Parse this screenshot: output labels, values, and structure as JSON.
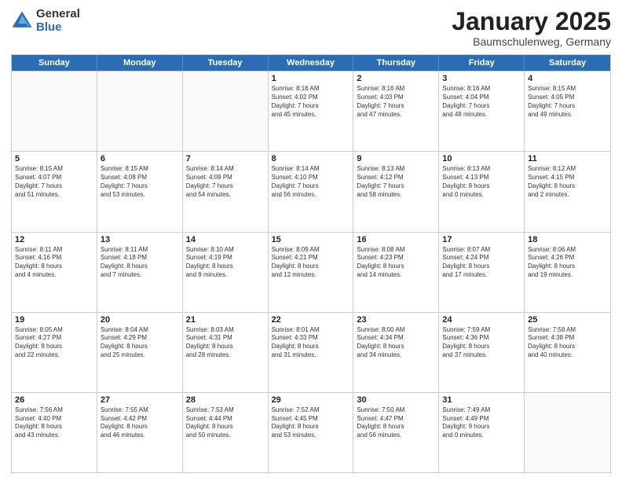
{
  "logo": {
    "general": "General",
    "blue": "Blue"
  },
  "header": {
    "month": "January 2025",
    "location": "Baumschulenweg, Germany"
  },
  "weekdays": [
    "Sunday",
    "Monday",
    "Tuesday",
    "Wednesday",
    "Thursday",
    "Friday",
    "Saturday"
  ],
  "weeks": [
    [
      {
        "day": "",
        "text": ""
      },
      {
        "day": "",
        "text": ""
      },
      {
        "day": "",
        "text": ""
      },
      {
        "day": "1",
        "text": "Sunrise: 8:16 AM\nSunset: 4:02 PM\nDaylight: 7 hours\nand 45 minutes."
      },
      {
        "day": "2",
        "text": "Sunrise: 8:16 AM\nSunset: 4:03 PM\nDaylight: 7 hours\nand 47 minutes."
      },
      {
        "day": "3",
        "text": "Sunrise: 8:16 AM\nSunset: 4:04 PM\nDaylight: 7 hours\nand 48 minutes."
      },
      {
        "day": "4",
        "text": "Sunrise: 8:15 AM\nSunset: 4:05 PM\nDaylight: 7 hours\nand 49 minutes."
      }
    ],
    [
      {
        "day": "5",
        "text": "Sunrise: 8:15 AM\nSunset: 4:07 PM\nDaylight: 7 hours\nand 51 minutes."
      },
      {
        "day": "6",
        "text": "Sunrise: 8:15 AM\nSunset: 4:08 PM\nDaylight: 7 hours\nand 53 minutes."
      },
      {
        "day": "7",
        "text": "Sunrise: 8:14 AM\nSunset: 4:09 PM\nDaylight: 7 hours\nand 54 minutes."
      },
      {
        "day": "8",
        "text": "Sunrise: 8:14 AM\nSunset: 4:10 PM\nDaylight: 7 hours\nand 56 minutes."
      },
      {
        "day": "9",
        "text": "Sunrise: 8:13 AM\nSunset: 4:12 PM\nDaylight: 7 hours\nand 58 minutes."
      },
      {
        "day": "10",
        "text": "Sunrise: 8:13 AM\nSunset: 4:13 PM\nDaylight: 8 hours\nand 0 minutes."
      },
      {
        "day": "11",
        "text": "Sunrise: 8:12 AM\nSunset: 4:15 PM\nDaylight: 8 hours\nand 2 minutes."
      }
    ],
    [
      {
        "day": "12",
        "text": "Sunrise: 8:11 AM\nSunset: 4:16 PM\nDaylight: 8 hours\nand 4 minutes."
      },
      {
        "day": "13",
        "text": "Sunrise: 8:11 AM\nSunset: 4:18 PM\nDaylight: 8 hours\nand 7 minutes."
      },
      {
        "day": "14",
        "text": "Sunrise: 8:10 AM\nSunset: 4:19 PM\nDaylight: 8 hours\nand 9 minutes."
      },
      {
        "day": "15",
        "text": "Sunrise: 8:09 AM\nSunset: 4:21 PM\nDaylight: 8 hours\nand 12 minutes."
      },
      {
        "day": "16",
        "text": "Sunrise: 8:08 AM\nSunset: 4:23 PM\nDaylight: 8 hours\nand 14 minutes."
      },
      {
        "day": "17",
        "text": "Sunrise: 8:07 AM\nSunset: 4:24 PM\nDaylight: 8 hours\nand 17 minutes."
      },
      {
        "day": "18",
        "text": "Sunrise: 8:06 AM\nSunset: 4:26 PM\nDaylight: 8 hours\nand 19 minutes."
      }
    ],
    [
      {
        "day": "19",
        "text": "Sunrise: 8:05 AM\nSunset: 4:27 PM\nDaylight: 8 hours\nand 22 minutes."
      },
      {
        "day": "20",
        "text": "Sunrise: 8:04 AM\nSunset: 4:29 PM\nDaylight: 8 hours\nand 25 minutes."
      },
      {
        "day": "21",
        "text": "Sunrise: 8:03 AM\nSunset: 4:31 PM\nDaylight: 8 hours\nand 28 minutes."
      },
      {
        "day": "22",
        "text": "Sunrise: 8:01 AM\nSunset: 4:33 PM\nDaylight: 8 hours\nand 31 minutes."
      },
      {
        "day": "23",
        "text": "Sunrise: 8:00 AM\nSunset: 4:34 PM\nDaylight: 8 hours\nand 34 minutes."
      },
      {
        "day": "24",
        "text": "Sunrise: 7:59 AM\nSunset: 4:36 PM\nDaylight: 8 hours\nand 37 minutes."
      },
      {
        "day": "25",
        "text": "Sunrise: 7:58 AM\nSunset: 4:38 PM\nDaylight: 8 hours\nand 40 minutes."
      }
    ],
    [
      {
        "day": "26",
        "text": "Sunrise: 7:56 AM\nSunset: 4:40 PM\nDaylight: 8 hours\nand 43 minutes."
      },
      {
        "day": "27",
        "text": "Sunrise: 7:55 AM\nSunset: 4:42 PM\nDaylight: 8 hours\nand 46 minutes."
      },
      {
        "day": "28",
        "text": "Sunrise: 7:53 AM\nSunset: 4:44 PM\nDaylight: 8 hours\nand 50 minutes."
      },
      {
        "day": "29",
        "text": "Sunrise: 7:52 AM\nSunset: 4:45 PM\nDaylight: 8 hours\nand 53 minutes."
      },
      {
        "day": "30",
        "text": "Sunrise: 7:50 AM\nSunset: 4:47 PM\nDaylight: 8 hours\nand 56 minutes."
      },
      {
        "day": "31",
        "text": "Sunrise: 7:49 AM\nSunset: 4:49 PM\nDaylight: 9 hours\nand 0 minutes."
      },
      {
        "day": "",
        "text": ""
      }
    ]
  ]
}
